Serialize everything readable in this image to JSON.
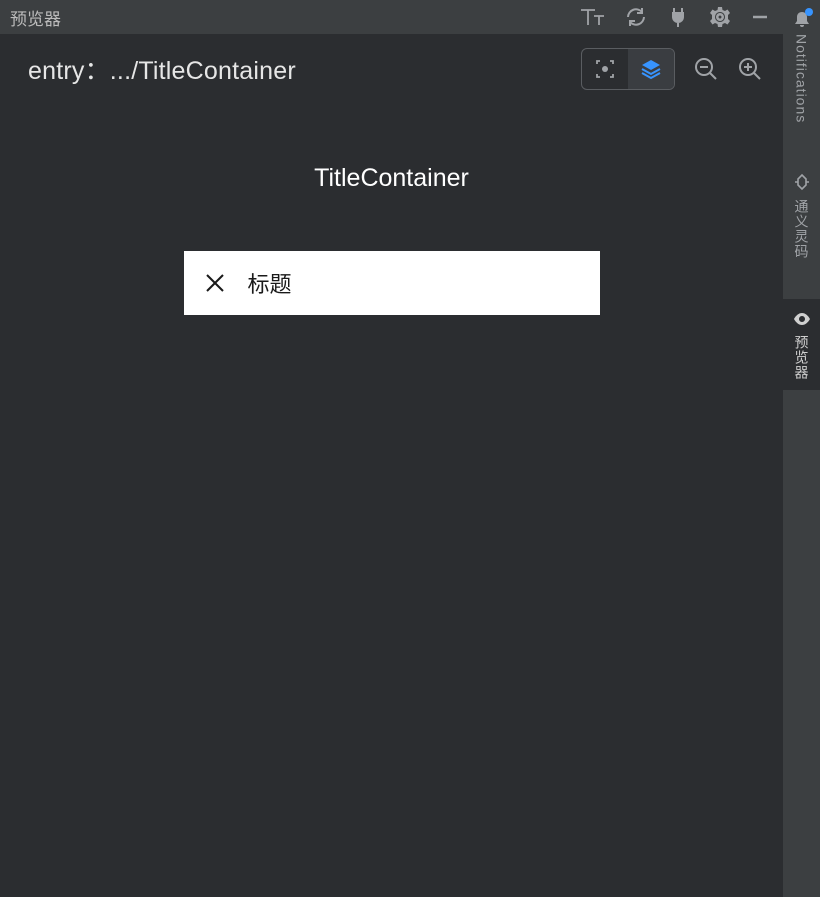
{
  "titlebar": {
    "title": "预览器"
  },
  "subheader": {
    "breadcrumb": "entry：.../TitleContainer"
  },
  "preview": {
    "componentName": "TitleContainer",
    "containerText": "标题"
  },
  "sidebar": {
    "items": [
      {
        "label": "Notifications"
      },
      {
        "label": "通义灵码"
      },
      {
        "label": "预览器"
      }
    ]
  }
}
